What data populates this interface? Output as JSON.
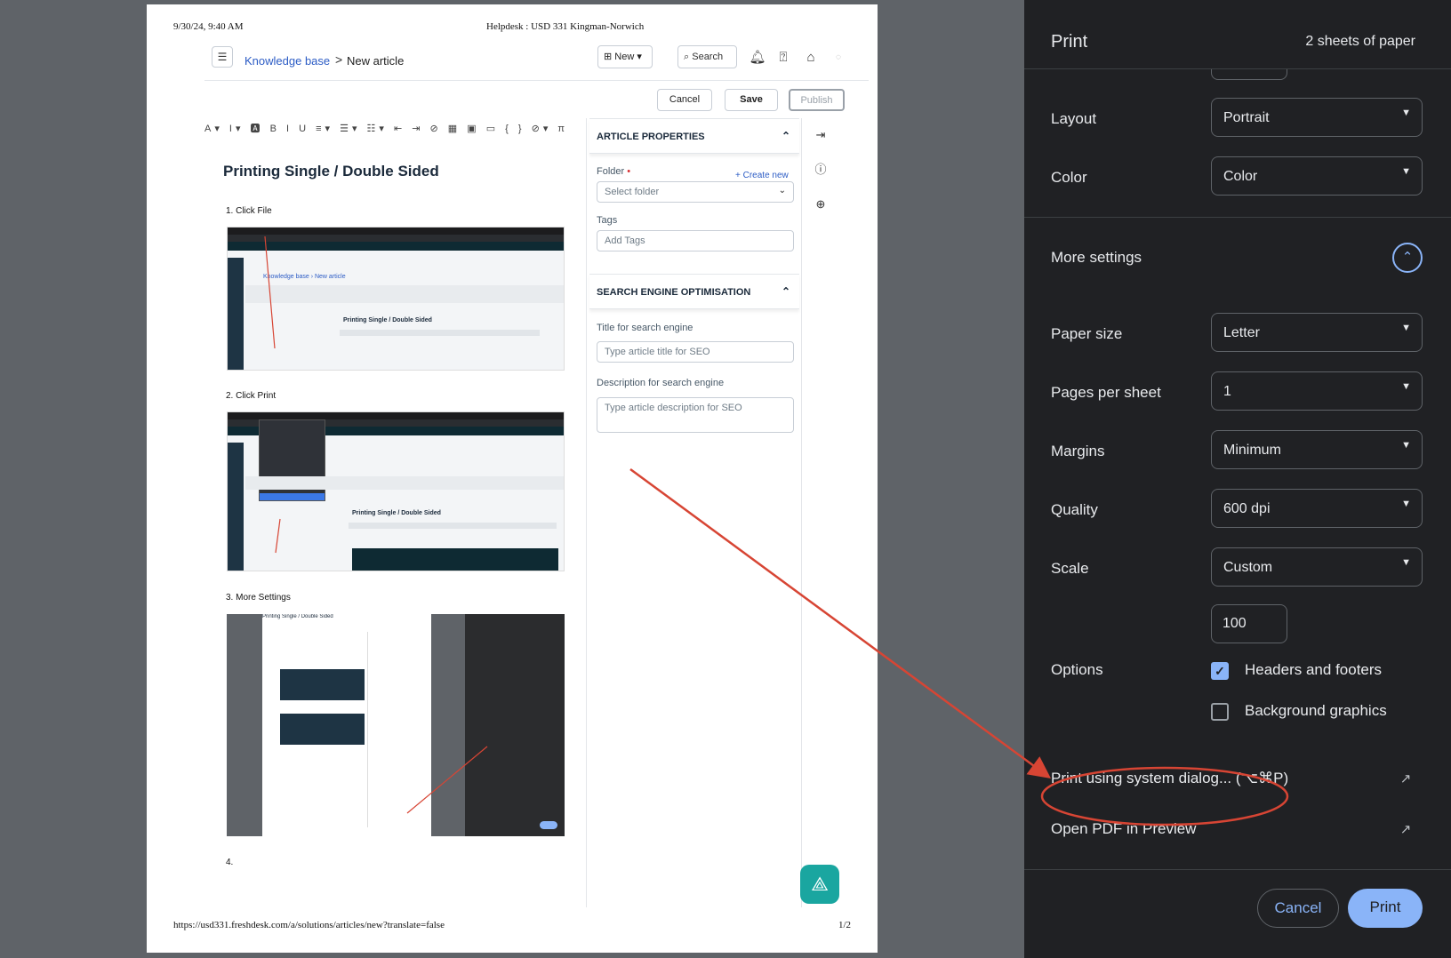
{
  "sheet": {
    "header_date": "9/30/24, 9:40 AM",
    "header_title": "Helpdesk : USD 331 Kingman-Norwich",
    "footer_url": "https://usd331.freshdesk.com/a/solutions/articles/new?translate=false",
    "footer_page": "1/2"
  },
  "app": {
    "breadcrumb_link": "Knowledge base",
    "breadcrumb_sep": ">",
    "breadcrumb_current": "New article",
    "new_label": "New",
    "search_label": "Search",
    "cancel_label": "Cancel",
    "save_label": "Save",
    "publish_label": "Publish"
  },
  "article": {
    "title": "Printing Single / Double Sided",
    "steps": [
      "1. Click File",
      "2. Click Print",
      "3.  More Settings",
      "4."
    ],
    "shot1_title": "Printing Single / Double Sided",
    "shot1_crumb": "Knowledge base  ›  New article",
    "shot2_title": "Printing Single / Double Sided",
    "shot3_title": "Printing Single / Double Sided"
  },
  "properties": {
    "section1": "ARTICLE PROPERTIES",
    "folder_label": "Folder",
    "required_mark": "•",
    "create_new": "+ Create new",
    "folder_placeholder": "Select folder",
    "tags_label": "Tags",
    "tags_placeholder": "Add Tags",
    "section2": "SEARCH ENGINE OPTIMISATION",
    "seo_title_label": "Title for search engine",
    "seo_title_placeholder": "Type article title for SEO",
    "seo_desc_label": "Description for search engine",
    "seo_desc_placeholder": "Type article description for SEO"
  },
  "print": {
    "title": "Print",
    "sheets": "2 sheets of paper",
    "layout_label": "Layout",
    "layout_value": "Portrait",
    "color_label": "Color",
    "color_value": "Color",
    "more_settings_label": "More settings",
    "paper_size_label": "Paper size",
    "paper_size_value": "Letter",
    "pages_per_sheet_label": "Pages per sheet",
    "pages_per_sheet_value": "1",
    "margins_label": "Margins",
    "margins_value": "Minimum",
    "quality_label": "Quality",
    "quality_value": "600 dpi",
    "scale_label": "Scale",
    "scale_value": "Custom",
    "scale_custom_value": "100",
    "options_label": "Options",
    "headers_footers_label": "Headers and footers",
    "headers_footers_checked": true,
    "background_graphics_label": "Background graphics",
    "background_graphics_checked": false,
    "system_dialog_label": "Print using system dialog... (⌥⌘P)",
    "open_pdf_label": "Open PDF in Preview",
    "cancel_label": "Cancel",
    "print_label": "Print"
  },
  "colors": {
    "accent": "#8ab4f8",
    "panel_bg": "#202124",
    "annotation": "#d74534",
    "link": "#2c5cc5"
  }
}
